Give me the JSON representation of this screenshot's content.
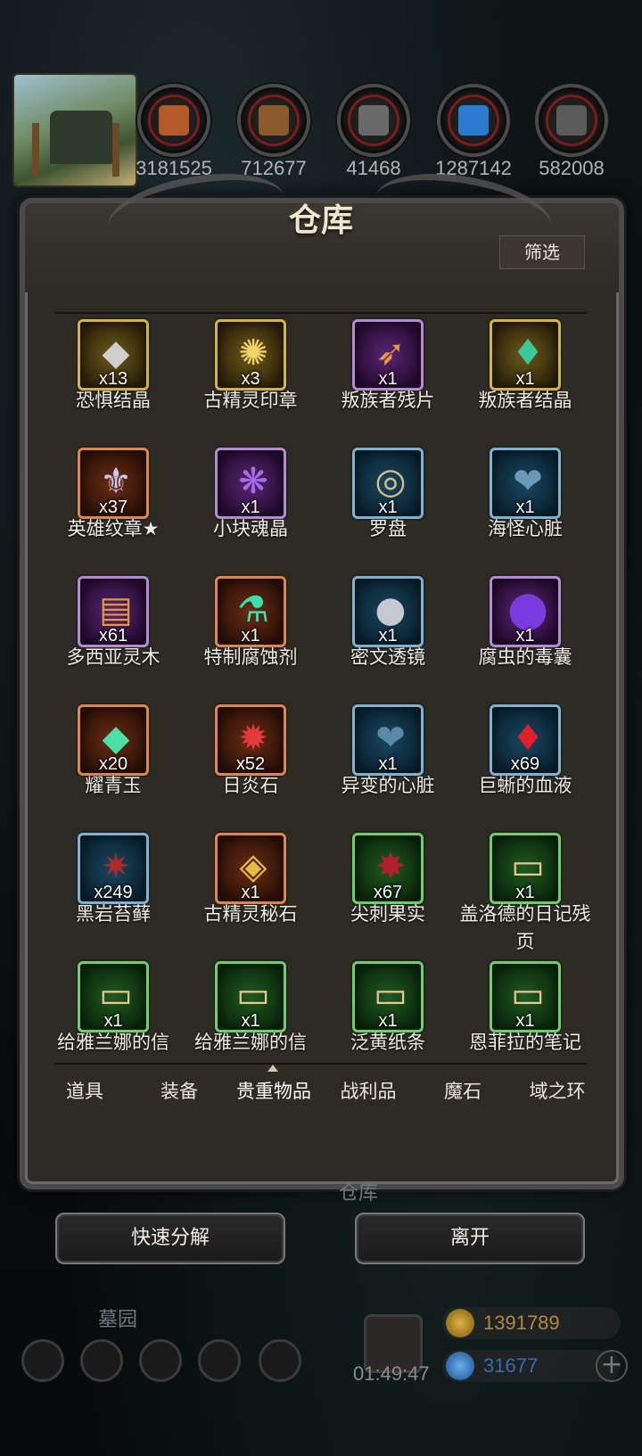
{
  "resources": [
    {
      "icon": "meat-icon",
      "value": "3181525",
      "color": "#b45a2a"
    },
    {
      "icon": "wood-icon",
      "value": "712677",
      "color": "#8a5a2a"
    },
    {
      "icon": "stone-icon",
      "value": "41468",
      "color": "#6a6a6a"
    },
    {
      "icon": "crystal-icon",
      "value": "1287142",
      "color": "#2a7ad0"
    },
    {
      "icon": "iron-icon",
      "value": "582008",
      "color": "#5a5a5a"
    }
  ],
  "panel": {
    "title": "仓库",
    "filter_label": "筛选"
  },
  "items": [
    {
      "name": "恐惧结晶",
      "qty": "x13",
      "frame": "gold",
      "icon": "◆",
      "icon_color": "#cfcfcf"
    },
    {
      "name": "古精灵印章",
      "qty": "x3",
      "frame": "gold",
      "icon": "✺",
      "icon_color": "#f2d36a"
    },
    {
      "name": "叛族者残片",
      "qty": "x1",
      "frame": "purple",
      "icon": "➶",
      "icon_color": "#e89a3a"
    },
    {
      "name": "叛族者结晶",
      "qty": "x1",
      "frame": "gold",
      "icon": "♦",
      "icon_color": "#3ac99a"
    },
    {
      "name": "英雄纹章★",
      "qty": "x37",
      "frame": "orange",
      "icon": "⚜",
      "icon_color": "#c9c9f2"
    },
    {
      "name": "小块魂晶",
      "qty": "x1",
      "frame": "purple",
      "icon": "❋",
      "icon_color": "#a86ae8"
    },
    {
      "name": "罗盘",
      "qty": "x1",
      "frame": "blue",
      "icon": "◎",
      "icon_color": "#d8c08a"
    },
    {
      "name": "海怪心脏",
      "qty": "x1",
      "frame": "blue",
      "icon": "❤",
      "icon_color": "#6a9ab8"
    },
    {
      "name": "多西亚灵木",
      "qty": "x61",
      "frame": "purple",
      "icon": "▤",
      "icon_color": "#e09a3a"
    },
    {
      "name": "特制腐蚀剂",
      "qty": "x1",
      "frame": "orange",
      "icon": "⚗",
      "icon_color": "#3ae0b0"
    },
    {
      "name": "密文透镜",
      "qty": "x1",
      "frame": "blue",
      "icon": "●",
      "icon_color": "#c8c8d0"
    },
    {
      "name": "腐虫的毒囊",
      "qty": "x1",
      "frame": "purple",
      "icon": "⬤",
      "icon_color": "#7a3ae0"
    },
    {
      "name": "耀青玉",
      "qty": "x20",
      "frame": "orange",
      "icon": "◆",
      "icon_color": "#4ae0a8"
    },
    {
      "name": "日炎石",
      "qty": "x52",
      "frame": "orange",
      "icon": "✹",
      "icon_color": "#e03a3a"
    },
    {
      "name": "异变的心脏",
      "qty": "x1",
      "frame": "blue",
      "icon": "❤",
      "icon_color": "#5a8aa8"
    },
    {
      "name": "巨蜥的血液",
      "qty": "x69",
      "frame": "blue",
      "icon": "♦",
      "icon_color": "#e0202a"
    },
    {
      "name": "黑岩苔藓",
      "qty": "x249",
      "frame": "blue",
      "icon": "✷",
      "icon_color": "#b02a2a"
    },
    {
      "name": "古精灵秘石",
      "qty": "x1",
      "frame": "orange",
      "icon": "◈",
      "icon_color": "#e0c040"
    },
    {
      "name": "尖刺果实",
      "qty": "x67",
      "frame": "green",
      "icon": "✸",
      "icon_color": "#b0202a"
    },
    {
      "name": "盖洛德的日记残页",
      "qty": "x1",
      "frame": "green",
      "icon": "▭",
      "icon_color": "#e8c890"
    },
    {
      "name": "给雅兰娜的信",
      "qty": "x1",
      "frame": "green",
      "icon": "▭",
      "icon_color": "#e8c890"
    },
    {
      "name": "给雅兰娜的信",
      "qty": "x1",
      "frame": "green",
      "icon": "▭",
      "icon_color": "#e8c890"
    },
    {
      "name": "泛黄纸条",
      "qty": "x1",
      "frame": "green",
      "icon": "▭",
      "icon_color": "#e8c890"
    },
    {
      "name": "恩菲拉的笔记",
      "qty": "x1",
      "frame": "green",
      "icon": "▭",
      "icon_color": "#e8c890"
    }
  ],
  "tabs": [
    "道具",
    "装备",
    "贵重物品",
    "战利品",
    "魔石",
    "域之环"
  ],
  "active_tab": "贵重物品",
  "buttons": {
    "quick_decompose": "快速分解",
    "leave": "离开"
  },
  "scene": {
    "under_label": "仓库",
    "graveyard_label": "墓园",
    "timer": "01:49:47",
    "gold": "1391789",
    "gems": "31677"
  }
}
